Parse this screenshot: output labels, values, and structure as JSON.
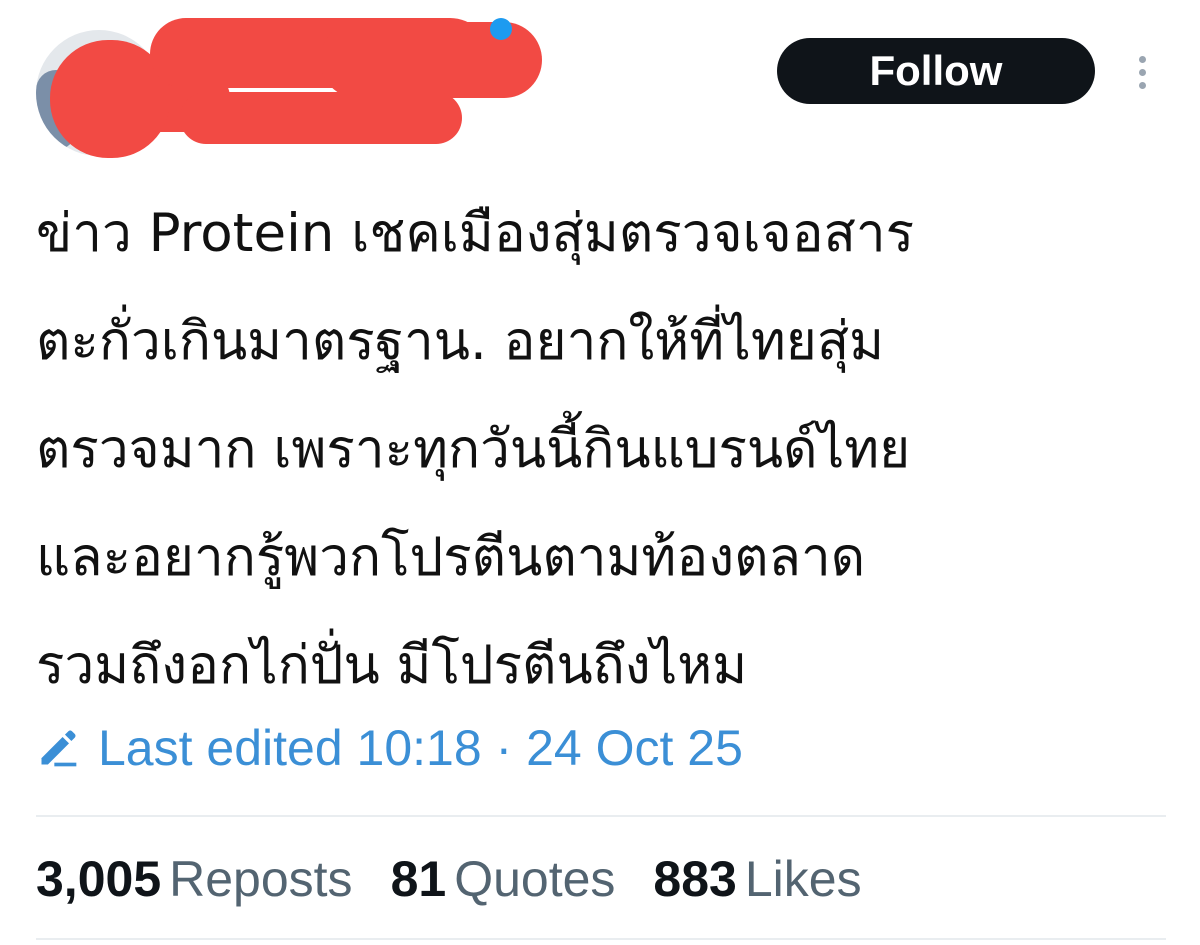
{
  "header": {
    "follow_label": "Follow"
  },
  "post": {
    "text_lines": [
      "ข่าว Protein เชคเมืองสุ่มตรวจเจอสาร",
      "ตะกั่วเกินมาตรฐาน. อยากให้ที่ไทยสุ่ม",
      "ตรวจมาก เพราะทุกวันนี้กินแบรนด์ไทย",
      "และอยากรู้พวกโปรตีนตามท้องตลาด",
      "รวมถึงอกไก่ปั่น มีโปรตีนถึงไหม"
    ],
    "edited_label": "Last edited 10:18 · 24 Oct 25"
  },
  "stats": {
    "reposts": {
      "count": "3,005",
      "label": "Reposts"
    },
    "quotes": {
      "count": "81",
      "label": "Quotes"
    },
    "likes": {
      "count": "883",
      "label": "Likes"
    }
  },
  "colors": {
    "follow_bg": "#0f1419",
    "link_blue": "#3b8fd6",
    "redaction": "#f24a44",
    "muted_text": "#536471"
  },
  "icons": {
    "edit": "pencil-icon",
    "more": "more-vertical-icon"
  }
}
